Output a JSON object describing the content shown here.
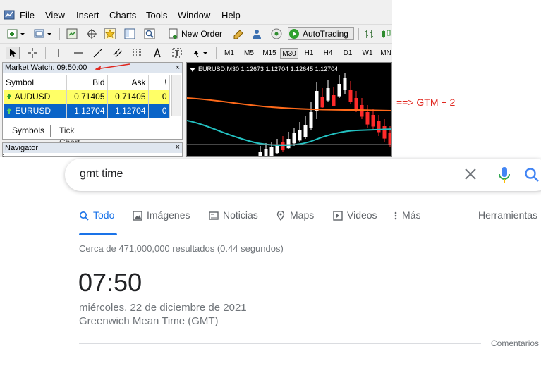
{
  "mt4": {
    "menu": [
      "File",
      "View",
      "Insert",
      "Charts",
      "Tools",
      "Window",
      "Help"
    ],
    "toolbar": {
      "new_order": "New Order",
      "autotrading": "AutoTrading"
    },
    "timeframes": [
      "M1",
      "M5",
      "M15",
      "M30",
      "H1",
      "H4",
      "D1",
      "W1",
      "MN"
    ],
    "active_timeframe": "M30",
    "market_watch": {
      "title": "Market Watch: 09:50:00",
      "close": "×",
      "columns": [
        "Symbol",
        "Bid",
        "Ask",
        "!"
      ],
      "rows": [
        {
          "symbol": "AUDUSD",
          "bid": "0.71405",
          "ask": "0.71405",
          "spread": "0"
        },
        {
          "symbol": "EURUSD",
          "bid": "1.12704",
          "ask": "1.12704",
          "spread": "0"
        }
      ],
      "tabs": [
        "Symbols",
        "Tick Chart"
      ]
    },
    "navigator": {
      "title": "Navigator",
      "close": "×"
    },
    "chart": {
      "label": "EURUSD,M30  1.12673 1.12704 1.12645 1.12704"
    },
    "annotation": "==> GTM + 2",
    "colors": {
      "highlight_row": "#ffff66",
      "selected_row": "#0a64c8",
      "annotation": "#e0261e"
    }
  },
  "google": {
    "query": "gmt time",
    "tabs": [
      "Todo",
      "Imágenes",
      "Noticias",
      "Maps",
      "Videos",
      "Más"
    ],
    "active_tab": "Todo",
    "tools": "Herramientas",
    "stats": "Cerca de 471,000,000 resultados (0.44 segundos)",
    "time": "07:50",
    "date": "miércoles, 22 de diciembre de 2021",
    "zone": "Greenwich Mean Time (GMT)",
    "feedback": "Comentarios",
    "colors": {
      "accent": "#1a73e8"
    }
  }
}
